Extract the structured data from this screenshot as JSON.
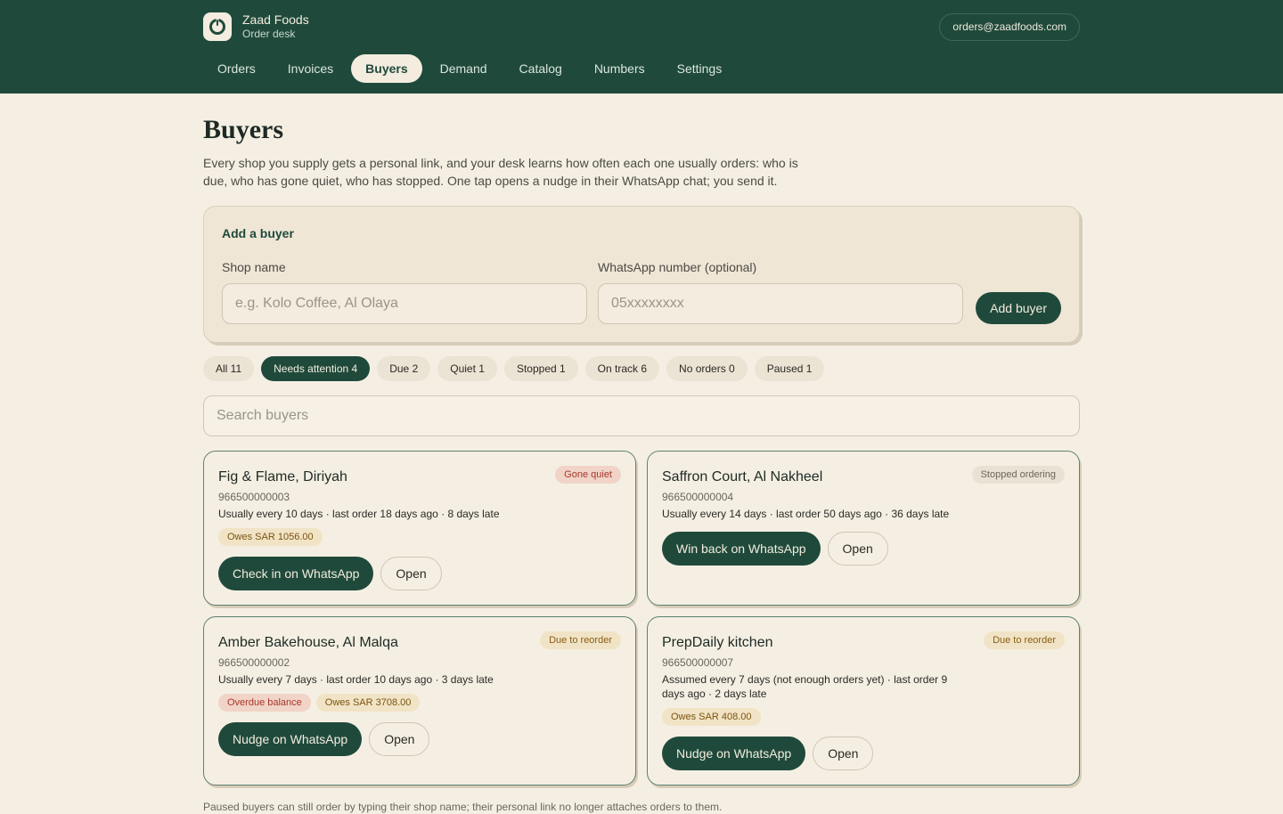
{
  "header": {
    "brand_name": "Zaad Foods",
    "brand_sub": "Order desk",
    "email": "orders@zaadfoods.com"
  },
  "nav": [
    {
      "label": "Orders",
      "active": false
    },
    {
      "label": "Invoices",
      "active": false
    },
    {
      "label": "Buyers",
      "active": true
    },
    {
      "label": "Demand",
      "active": false
    },
    {
      "label": "Catalog",
      "active": false
    },
    {
      "label": "Numbers",
      "active": false
    },
    {
      "label": "Settings",
      "active": false
    }
  ],
  "page": {
    "title": "Buyers",
    "description": "Every shop you supply gets a personal link, and your desk learns how often each one usually orders: who is due, who has gone quiet, who has stopped. One tap opens a nudge in their WhatsApp chat; you send it."
  },
  "add_buyer": {
    "title": "Add a buyer",
    "shop_label": "Shop name",
    "shop_placeholder": "e.g. Kolo Coffee, Al Olaya",
    "whatsapp_label": "WhatsApp number (optional)",
    "whatsapp_placeholder": "05xxxxxxxx",
    "button": "Add buyer"
  },
  "filters": [
    {
      "label": "All 11",
      "active": false
    },
    {
      "label": "Needs attention 4",
      "active": true
    },
    {
      "label": "Due 2",
      "active": false
    },
    {
      "label": "Quiet 1",
      "active": false
    },
    {
      "label": "Stopped 1",
      "active": false
    },
    {
      "label": "On track 6",
      "active": false
    },
    {
      "label": "No orders 0",
      "active": false
    },
    {
      "label": "Paused 1",
      "active": false
    }
  ],
  "search": {
    "placeholder": "Search buyers"
  },
  "buyers": [
    {
      "name": "Fig & Flame, Diriyah",
      "phone": "966500000003",
      "note": "Usually every 10 days · last order 18 days ago · 8 days late",
      "status": "Gone quiet",
      "status_tone": "red",
      "badges": [
        {
          "label": "Owes SAR 1056.00",
          "tone": "owes"
        }
      ],
      "primary": "Check in on WhatsApp",
      "secondary": "Open"
    },
    {
      "name": "Saffron Court, Al Nakheel",
      "phone": "966500000004",
      "note": "Usually every 14 days · last order 50 days ago · 36 days late",
      "status": "Stopped ordering",
      "status_tone": "grey",
      "badges": [],
      "primary": "Win back on WhatsApp",
      "secondary": "Open"
    },
    {
      "name": "Amber Bakehouse, Al Malqa",
      "phone": "966500000002",
      "note": "Usually every 7 days · last order 10 days ago · 3 days late",
      "status": "Due to reorder",
      "status_tone": "amber",
      "badges": [
        {
          "label": "Overdue balance",
          "tone": "overdue"
        },
        {
          "label": "Owes SAR 3708.00",
          "tone": "owes"
        }
      ],
      "primary": "Nudge on WhatsApp",
      "secondary": "Open"
    },
    {
      "name": "PrepDaily kitchen",
      "phone": "966500000007",
      "note": "Assumed every 7 days (not enough orders yet) · last order 9 days ago · 2 days late",
      "status": "Due to reorder",
      "status_tone": "amber",
      "badges": [
        {
          "label": "Owes SAR 408.00",
          "tone": "owes"
        }
      ],
      "primary": "Nudge on WhatsApp",
      "secondary": "Open"
    }
  ],
  "footnote": "Paused buyers can still order by typing their shop name; their personal link no longer attaches orders to them.",
  "colors": {
    "brand": "#1f4a3b",
    "background": "#f5efe3",
    "accent_light": "#f3ecdf"
  },
  "icons": {
    "logo": "power-ring-icon"
  }
}
